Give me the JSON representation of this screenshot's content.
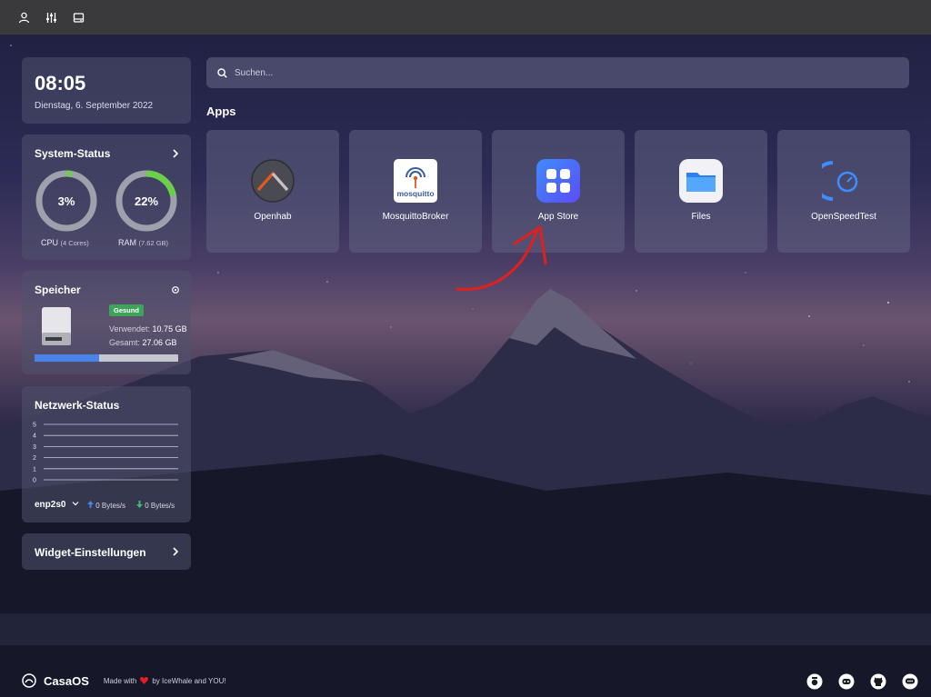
{
  "colors": {
    "accent_green": "#6ccf4a",
    "storage_fill": "#4a82e8",
    "badge_green": "#3fa35a",
    "annotation_red": "#e0201e",
    "topbar": "#3a3a3c"
  },
  "topbar": {
    "icons": [
      "user-icon",
      "sliders-icon",
      "drive-icon"
    ]
  },
  "clock": {
    "time": "08:05",
    "date": "Dienstag, 6. September 2022"
  },
  "system_status": {
    "title": "System-Status",
    "cpu": {
      "value": "3%",
      "percent": 3,
      "label": "CPU",
      "detail": "(4 Cores)"
    },
    "ram": {
      "value": "22%",
      "percent": 22,
      "label": "RAM",
      "detail": "(7.62 GB)"
    }
  },
  "storage": {
    "title": "Speicher",
    "status": "Gesund",
    "used_label": "Verwendet:",
    "used_value": "10.75 GB",
    "total_label": "Gesamt:",
    "total_value": "27.06 GB",
    "used_fraction": 0.45
  },
  "network": {
    "title": "Netzwerk-Status",
    "y_ticks": [
      "5",
      "4",
      "3",
      "2",
      "1",
      "0"
    ],
    "interface": "enp2s0",
    "upload": "0 Bytes/s",
    "download": "0 Bytes/s"
  },
  "widget_settings": {
    "label": "Widget-Einstellungen"
  },
  "search": {
    "placeholder": "Suchen..."
  },
  "apps": {
    "heading": "Apps",
    "items": [
      {
        "label": "Openhab",
        "icon": "openhab-icon"
      },
      {
        "label": "MosquittoBroker",
        "icon": "mosquitto-icon",
        "icon_text": "mosquitto"
      },
      {
        "label": "App Store",
        "icon": "app-store-icon"
      },
      {
        "label": "Files",
        "icon": "files-folder-icon"
      },
      {
        "label": "OpenSpeedTest",
        "icon": "speedtest-icon"
      }
    ]
  },
  "footer": {
    "brand": "CasaOS",
    "made_with": "Made with",
    "by": "by IceWhale and YOU!",
    "icons": [
      "contact-icon",
      "discord-icon",
      "github-icon",
      "chat-icon"
    ]
  }
}
